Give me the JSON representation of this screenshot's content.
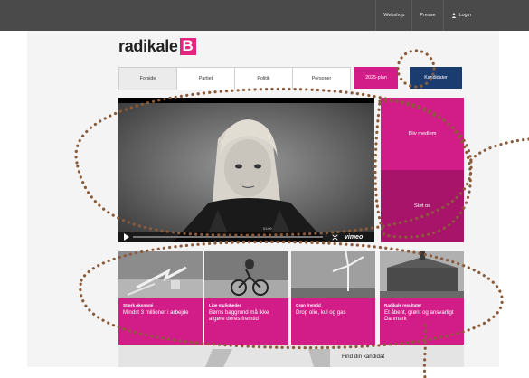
{
  "topbar": {
    "links": [
      "Webshop",
      "Presse",
      "Login"
    ]
  },
  "logo": {
    "word": "radikale",
    "badge": "B"
  },
  "nav": {
    "tabs": [
      "Forside",
      "Partiet",
      "Politik",
      "Personer"
    ],
    "active_index": 0,
    "plan_label": "2025-plan",
    "kandidater_label": "Kandidater"
  },
  "video": {
    "time": "01:09",
    "brand": "vimeo"
  },
  "side_buttons": {
    "member": "Bliv medlem",
    "support": "Støt os"
  },
  "cards": [
    {
      "title": "Stærk økonomi",
      "desc": "Mindst 3 millioner i arbejde"
    },
    {
      "title": "Lige muligheder",
      "desc": "Børns baggrund må ikke afgøre deres fremtid"
    },
    {
      "title": "Grøn fremtid",
      "desc": "Drop olie, kul og gas"
    },
    {
      "title": "Radikale resultater",
      "desc": "Et åbent, grønt og ansvarligt Danmark"
    }
  ],
  "finder": {
    "label": "Find din kandidat"
  },
  "colors": {
    "accent": "#d21c87",
    "accent_dark": "#a8146a",
    "navy": "#1b3c6e",
    "annotation": "#8a5b3a"
  }
}
